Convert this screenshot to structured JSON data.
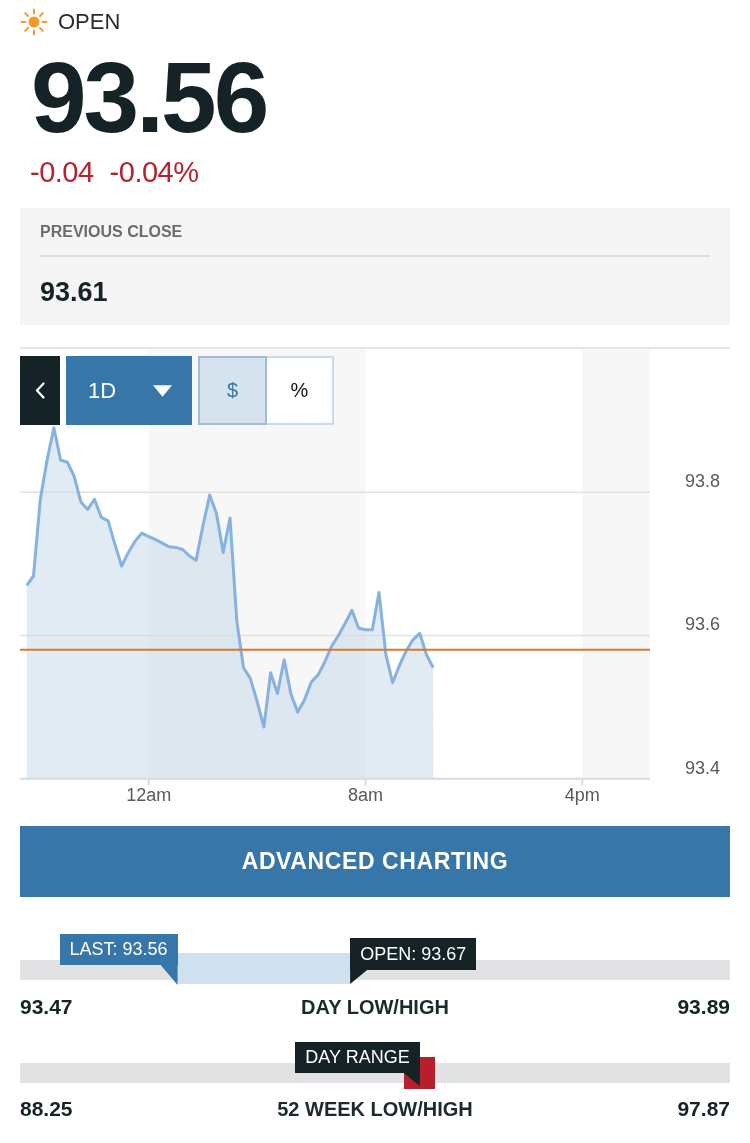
{
  "status": {
    "label": "OPEN"
  },
  "quote": {
    "price": "93.56",
    "change": "-0.04",
    "change_percent": "-0.04%"
  },
  "previous_close": {
    "label": "PREVIOUS CLOSE",
    "value": "93.61"
  },
  "chart": {
    "timeframe": {
      "label": "1D"
    },
    "units": [
      {
        "label": "$",
        "selected": true
      },
      {
        "label": "%",
        "selected": false
      }
    ],
    "chart_data": {
      "type": "area",
      "categories": [
        null,
        null,
        null,
        null,
        null,
        null,
        null,
        null,
        null,
        null,
        null,
        null,
        null,
        null,
        null,
        null,
        null,
        null,
        null,
        "12am",
        null,
        null,
        null,
        null,
        null,
        null,
        null,
        null,
        null,
        null,
        null,
        null,
        null,
        null,
        null,
        null,
        null,
        null,
        null,
        null,
        null,
        null,
        null,
        null,
        null,
        null,
        null,
        null,
        null,
        null,
        null,
        "8am",
        null,
        null,
        null,
        null,
        null,
        null,
        null,
        null,
        null,
        null,
        null,
        null,
        null,
        null,
        null,
        null,
        null,
        null,
        null,
        null,
        null,
        null,
        null,
        null,
        null,
        null,
        null,
        null,
        null,
        null,
        null,
        "4pm",
        null,
        null,
        null,
        null,
        null,
        null,
        null,
        null,
        null,
        null
      ],
      "values": [
        null,
        93.67,
        93.683,
        93.79,
        93.845,
        93.89,
        93.845,
        93.842,
        93.822,
        93.786,
        93.776,
        93.79,
        93.765,
        93.76,
        93.728,
        93.697,
        93.716,
        93.732,
        93.743,
        93.738,
        93.734,
        93.729,
        93.724,
        93.723,
        93.72,
        93.711,
        93.705,
        93.753,
        93.796,
        93.77,
        93.716,
        93.764,
        93.62,
        93.555,
        93.54,
        93.508,
        93.472,
        93.548,
        93.519,
        93.566,
        93.518,
        93.493,
        93.51,
        93.535,
        93.545,
        93.563,
        93.585,
        93.6,
        93.617,
        93.635,
        93.61,
        93.608,
        93.608,
        93.66,
        93.574,
        93.534,
        93.558,
        93.578,
        93.594,
        93.603,
        93.573,
        93.555,
        null,
        null,
        null,
        null,
        null,
        null,
        null,
        null,
        null,
        null,
        null,
        null,
        null,
        null,
        null,
        null,
        null,
        null,
        null,
        null,
        null,
        null,
        null,
        null,
        null,
        null,
        null,
        null,
        null,
        null,
        null,
        null
      ],
      "ylim": [
        93.4,
        94.0
      ],
      "yticks": [
        93.4,
        93.6,
        93.8
      ],
      "ref_lines": [
        {
          "axis": "y",
          "value": 93.58
        }
      ]
    }
  },
  "advanced_button": {
    "label": "ADVANCED CHARTING"
  },
  "ranges": [
    {
      "kind": "day",
      "low": "93.47",
      "label": "DAY LOW/HIGH",
      "high": "93.89",
      "markers": [
        {
          "kind": "last",
          "label": "LAST: 93.56",
          "level": 0.222
        },
        {
          "kind": "open",
          "label": "OPEN: 93.67",
          "level": 0.465
        }
      ]
    },
    {
      "kind": "week52",
      "low": "88.25",
      "label": "52 WEEK LOW/HIGH",
      "high": "97.87",
      "markers": [
        {
          "kind": "day_range",
          "label": "DAY RANGE",
          "level": 0.563
        }
      ]
    }
  ]
}
